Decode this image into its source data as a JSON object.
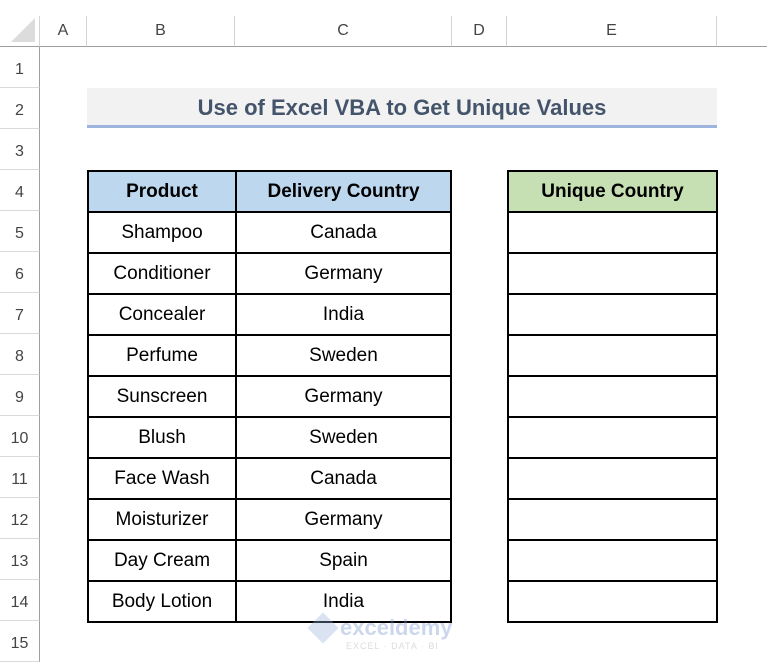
{
  "columns": [
    "A",
    "B",
    "C",
    "D",
    "E"
  ],
  "rows": [
    "1",
    "2",
    "3",
    "4",
    "5",
    "6",
    "7",
    "8",
    "9",
    "10",
    "11",
    "12",
    "13",
    "14",
    "15"
  ],
  "title": "Use of Excel VBA to Get Unique Values",
  "source_table": {
    "headers": [
      "Product",
      "Delivery Country"
    ],
    "rows": [
      [
        "Shampoo",
        "Canada"
      ],
      [
        "Conditioner",
        "Germany"
      ],
      [
        "Concealer",
        "India"
      ],
      [
        "Perfume",
        "Sweden"
      ],
      [
        "Sunscreen",
        "Germany"
      ],
      [
        "Blush",
        "Sweden"
      ],
      [
        "Face Wash",
        "Canada"
      ],
      [
        "Moisturizer",
        "Germany"
      ],
      [
        "Day Cream",
        "Spain"
      ],
      [
        "Body Lotion",
        "India"
      ]
    ]
  },
  "unique_table": {
    "header": "Unique Country",
    "rows": [
      "",
      "",
      "",
      "",
      "",
      "",
      "",
      "",
      "",
      ""
    ]
  },
  "watermark": {
    "name": "exceldemy",
    "tagline": "EXCEL · DATA · BI"
  },
  "colors": {
    "source_header": "#bdd7ee",
    "unique_header": "#c6e0b4",
    "title_text": "#44546a",
    "title_underline": "#9db4de"
  }
}
